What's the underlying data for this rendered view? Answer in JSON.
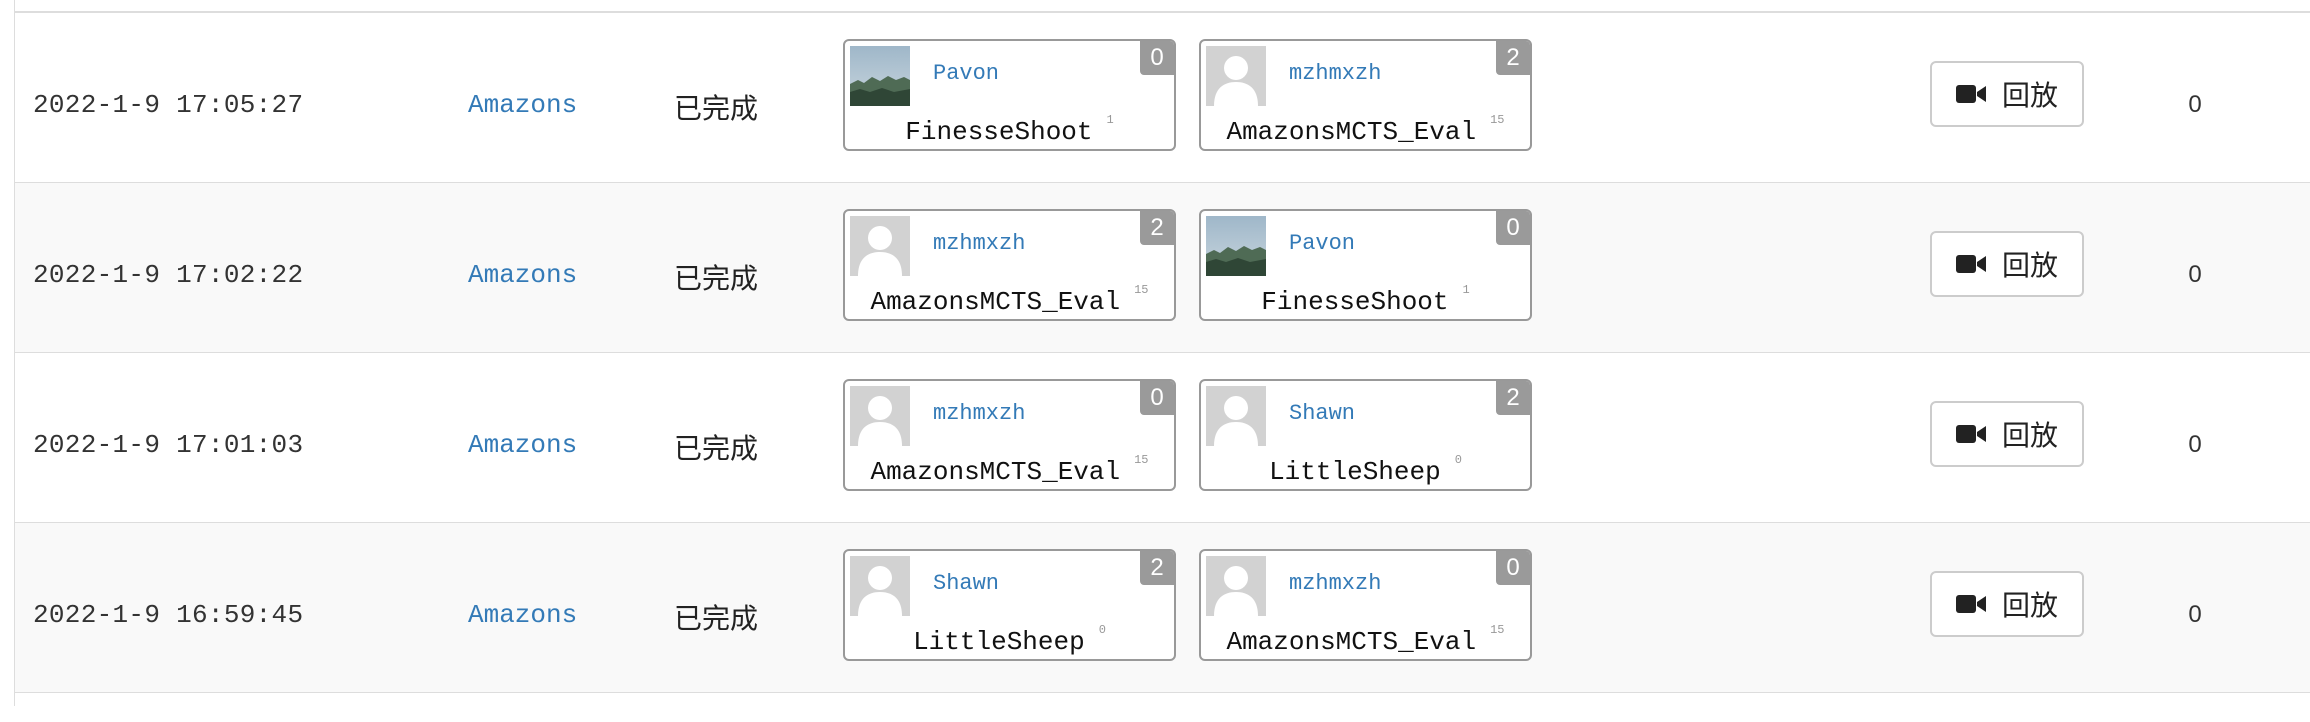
{
  "replay_label": "回放",
  "icons": {
    "replay": "video-camera-icon",
    "avatar_default": "user-silhouette-icon",
    "avatar_photo": "landscape-photo-icon"
  },
  "colors": {
    "link": "#337ab7",
    "score_badge": "#9a9a9a",
    "row_alt": "#f9f9f9"
  },
  "rows": [
    {
      "time": "2022-1-9 17:05:27",
      "game": "Amazons",
      "status": "已完成",
      "count": "0",
      "p1": {
        "user": "Pavon",
        "bot": "FinesseShoot",
        "ver": "1",
        "score": "0",
        "avatar": "photo"
      },
      "p2": {
        "user": "mzhmxzh",
        "bot": "AmazonsMCTS_Eval",
        "ver": "15",
        "score": "2",
        "avatar": "default"
      }
    },
    {
      "time": "2022-1-9 17:02:22",
      "game": "Amazons",
      "status": "已完成",
      "count": "0",
      "p1": {
        "user": "mzhmxzh",
        "bot": "AmazonsMCTS_Eval",
        "ver": "15",
        "score": "2",
        "avatar": "default"
      },
      "p2": {
        "user": "Pavon",
        "bot": "FinesseShoot",
        "ver": "1",
        "score": "0",
        "avatar": "photo"
      }
    },
    {
      "time": "2022-1-9 17:01:03",
      "game": "Amazons",
      "status": "已完成",
      "count": "0",
      "p1": {
        "user": "mzhmxzh",
        "bot": "AmazonsMCTS_Eval",
        "ver": "15",
        "score": "0",
        "avatar": "default"
      },
      "p2": {
        "user": "Shawn",
        "bot": "LittleSheep",
        "ver": "0",
        "score": "2",
        "avatar": "default"
      }
    },
    {
      "time": "2022-1-9 16:59:45",
      "game": "Amazons",
      "status": "已完成",
      "count": "0",
      "p1": {
        "user": "Shawn",
        "bot": "LittleSheep",
        "ver": "0",
        "score": "2",
        "avatar": "default"
      },
      "p2": {
        "user": "mzhmxzh",
        "bot": "AmazonsMCTS_Eval",
        "ver": "15",
        "score": "0",
        "avatar": "default"
      }
    }
  ]
}
